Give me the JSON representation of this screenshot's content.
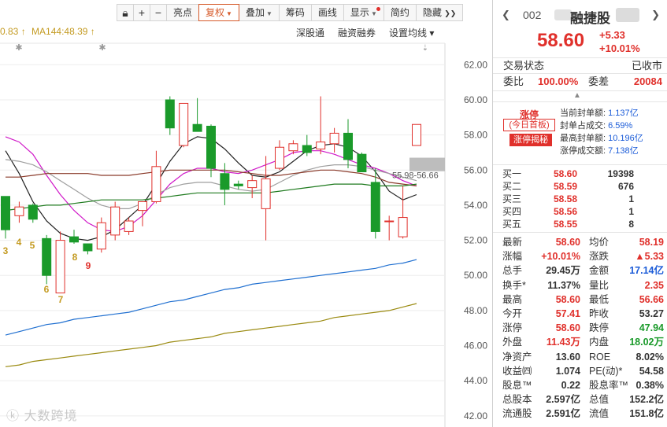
{
  "toolbar": {
    "lock_icon": "lock-icon",
    "zoom_in": "+",
    "zoom_out": "−",
    "highlights": "亮点",
    "adjust": "复权",
    "overlay": "叠加",
    "chips": "筹码",
    "draw": "画线",
    "display": "显示",
    "simple": "简约",
    "hide": "隐藏",
    "more": "❯❯"
  },
  "ma_legend": {
    "left_value": "0.83 ↑",
    "ma144": "MA144:48.39 ↑"
  },
  "chart_links": [
    "深股通",
    "融资融券",
    "设置均线 ▾"
  ],
  "chart_data": {
    "type": "candlestick",
    "y_ticks": [
      "62.00",
      "60.00",
      "58.00",
      "56.00",
      "54.00",
      "52.00",
      "50.00",
      "48.00",
      "46.00",
      "44.00",
      "42.00"
    ],
    "ylim": [
      41.5,
      63
    ],
    "price_range_label": "55.98-56.66",
    "day_labels": [
      {
        "text": "3",
        "color": "#c49b22"
      },
      {
        "text": "4",
        "color": "#c49b22"
      },
      {
        "text": "5",
        "color": "#c49b22"
      },
      {
        "text": "6",
        "color": "#c49b22"
      },
      {
        "text": "7",
        "color": "#c49b22"
      },
      {
        "text": "8",
        "color": "#c49b22"
      },
      {
        "text": "9",
        "color": "#e0302b"
      }
    ],
    "candles": [
      {
        "o": 54.5,
        "h": 54.5,
        "l": 52.1,
        "c": 52.6
      },
      {
        "o": 53.4,
        "h": 54.2,
        "l": 53.0,
        "c": 53.9
      },
      {
        "o": 54.0,
        "h": 54.1,
        "l": 53.0,
        "c": 53.2
      },
      {
        "o": 52.1,
        "h": 52.3,
        "l": 49.5,
        "c": 50.0
      },
      {
        "o": 49.0,
        "h": 52.5,
        "l": 49.0,
        "c": 52.0
      },
      {
        "o": 52.2,
        "h": 52.6,
        "l": 51.8,
        "c": 51.9
      },
      {
        "o": 51.8,
        "h": 51.8,
        "l": 51.2,
        "c": 51.4
      },
      {
        "o": 51.5,
        "h": 53.3,
        "l": 51.3,
        "c": 53.0
      },
      {
        "o": 52.3,
        "h": 54.2,
        "l": 52.0,
        "c": 53.9
      },
      {
        "o": 52.5,
        "h": 53.3,
        "l": 52.3,
        "c": 53.1
      },
      {
        "o": 53.7,
        "h": 54.2,
        "l": 52.8,
        "c": 54.2
      },
      {
        "o": 54.2,
        "h": 57.1,
        "l": 54.1,
        "c": 56.2
      },
      {
        "o": 60.0,
        "h": 60.2,
        "l": 58.0,
        "c": 58.4
      },
      {
        "o": 57.4,
        "h": 59.8,
        "l": 57.3,
        "c": 59.8
      },
      {
        "o": 58.6,
        "h": 60.1,
        "l": 58.2,
        "c": 58.2
      },
      {
        "o": 58.5,
        "h": 58.6,
        "l": 55.6,
        "c": 56.1
      },
      {
        "o": 55.8,
        "h": 56.4,
        "l": 54.0,
        "c": 54.9
      },
      {
        "o": 55.2,
        "h": 55.4,
        "l": 54.9,
        "c": 55.1
      },
      {
        "o": 55.0,
        "h": 55.7,
        "l": 54.4,
        "c": 55.4
      },
      {
        "o": 53.8,
        "h": 56.8,
        "l": 52.0,
        "c": 55.5
      },
      {
        "o": 56.1,
        "h": 57.7,
        "l": 56.0,
        "c": 57.3
      },
      {
        "o": 57.1,
        "h": 57.7,
        "l": 56.9,
        "c": 57.5
      },
      {
        "o": 57.4,
        "h": 58.0,
        "l": 56.8,
        "c": 57.0
      },
      {
        "o": 57.2,
        "h": 60.2,
        "l": 56.9,
        "c": 57.6
      },
      {
        "o": 57.5,
        "h": 58.4,
        "l": 57.0,
        "c": 58.1
      },
      {
        "o": 58.1,
        "h": 58.9,
        "l": 56.1,
        "c": 56.6
      },
      {
        "o": 56.9,
        "h": 57.0,
        "l": 55.9,
        "c": 55.9
      },
      {
        "o": 55.3,
        "h": 56.1,
        "l": 52.1,
        "c": 52.5
      },
      {
        "o": 53.1,
        "h": 53.4,
        "l": 52.0,
        "c": 53.1
      },
      {
        "o": 52.2,
        "h": 55.1,
        "l": 52.1,
        "c": 53.3
      },
      {
        "o": 57.4,
        "h": 58.6,
        "l": 57.4,
        "c": 58.6
      }
    ],
    "series": [
      {
        "color": "#222222",
        "values": [
          57.1,
          55.8,
          54.2,
          53.1,
          52.4,
          52.1,
          52.0,
          52.2,
          52.6,
          53.3,
          54.0,
          55.2,
          56.5,
          57.5,
          57.9,
          57.8,
          57.2,
          56.4,
          55.7,
          55.6,
          55.9,
          56.5,
          57.1,
          57.4,
          57.5,
          57.3,
          56.8,
          55.9,
          54.8,
          54.3,
          54.6
        ]
      },
      {
        "color": "#d018c8",
        "values": [
          57.9,
          57.6,
          56.9,
          55.7,
          54.6,
          53.7,
          53.0,
          52.6,
          52.5,
          52.8,
          53.4,
          54.3,
          55.2,
          55.8,
          56.1,
          56.1,
          55.9,
          55.8,
          56.0,
          56.3,
          56.6,
          57.0,
          57.1,
          57.1,
          56.9,
          56.6,
          56.3,
          56.1,
          55.8,
          55.4,
          55.1
        ]
      },
      {
        "color": "#9e9e9e",
        "values": [
          56.6,
          56.5,
          56.3,
          55.9,
          55.4,
          54.9,
          54.4,
          54.0,
          53.8,
          53.8,
          54.1,
          54.6,
          55.0,
          55.2,
          55.3,
          55.3,
          55.1,
          54.9,
          54.8,
          54.9,
          55.3,
          55.7,
          56.0,
          56.2,
          56.3,
          56.3,
          56.2,
          56.0,
          55.8,
          55.6,
          55.4
        ]
      },
      {
        "color": "#8a3a2a",
        "values": [
          55.6,
          55.6,
          55.7,
          55.8,
          55.8,
          55.8,
          55.8,
          55.7,
          55.7,
          55.7,
          55.8,
          55.9,
          56.0,
          56.0,
          56.0,
          56.0,
          56.0,
          55.9,
          55.8,
          55.7,
          55.7,
          55.8,
          55.9,
          56.0,
          56.0,
          55.9,
          55.8,
          55.6,
          55.3,
          55.2,
          55.1
        ]
      },
      {
        "color": "#1e7a1e",
        "values": [
          53.7,
          53.8,
          53.9,
          54.0,
          54.0,
          54.1,
          54.2,
          54.3,
          54.3,
          54.3,
          54.3,
          54.4,
          54.5,
          54.6,
          54.7,
          54.7,
          54.7,
          54.7,
          54.7,
          54.7,
          54.8,
          54.9,
          55.0,
          55.1,
          55.2,
          55.2,
          55.2,
          55.1,
          55.1,
          55.1,
          55.2
        ]
      },
      {
        "color": "#1f6fd0",
        "values": [
          46.6,
          46.8,
          47.0,
          47.2,
          47.3,
          47.5,
          47.6,
          47.7,
          47.8,
          47.9,
          48.1,
          48.3,
          48.5,
          48.6,
          48.8,
          49.0,
          49.2,
          49.3,
          49.5,
          49.6,
          49.7,
          49.8,
          49.9,
          50.0,
          50.1,
          50.2,
          50.3,
          50.4,
          50.6,
          50.7,
          50.9
        ]
      },
      {
        "color": "#9a8a10",
        "values": [
          44.8,
          44.9,
          45.1,
          45.2,
          45.3,
          45.4,
          45.5,
          45.6,
          45.7,
          45.8,
          45.9,
          46.0,
          46.2,
          46.3,
          46.4,
          46.5,
          46.7,
          46.8,
          46.9,
          47.0,
          47.1,
          47.2,
          47.3,
          47.4,
          47.6,
          47.7,
          47.8,
          47.9,
          48.0,
          48.2,
          48.4
        ]
      }
    ]
  },
  "watermark": "大数跨境",
  "stock": {
    "code": "002",
    "name": "融捷股",
    "price": "58.60",
    "change": "+5.33",
    "change_pct": "+10.01%"
  },
  "status": {
    "label": "交易状态",
    "value": "已收市",
    "weibi_label": "委比",
    "weibi_value": "100.00%",
    "weicha_label": "委差",
    "weicha_value": "20084"
  },
  "limit_up": {
    "title": "涨停",
    "first_board": "(今日首板)",
    "secret": "涨停揭秘",
    "lines": [
      {
        "label": "当前封单额:",
        "value": "1.137亿"
      },
      {
        "label": "封单占成交:",
        "value": "6.59%"
      },
      {
        "label": "最高封单额:",
        "value": "10.196亿"
      },
      {
        "label": "涨停成交额:",
        "value": "7.138亿"
      }
    ]
  },
  "order_book": [
    {
      "label": "买一",
      "price": "58.60",
      "vol": "19398"
    },
    {
      "label": "买二",
      "price": "58.59",
      "vol": "676"
    },
    {
      "label": "买三",
      "price": "58.58",
      "vol": "1"
    },
    {
      "label": "买四",
      "price": "58.56",
      "vol": "1"
    },
    {
      "label": "买五",
      "price": "58.55",
      "vol": "8"
    }
  ],
  "stats": [
    {
      "l1": "最新",
      "v1": "58.60",
      "c1": "red",
      "l2": "均价",
      "v2": "58.19",
      "c2": "red"
    },
    {
      "l1": "涨幅",
      "v1": "+10.01%",
      "c1": "red",
      "l2": "涨跌",
      "v2": "▲5.33",
      "c2": "red"
    },
    {
      "l1": "总手",
      "v1": "29.45万",
      "c1": "dark",
      "l2": "金额",
      "v2": "17.14亿",
      "c2": "blue"
    },
    {
      "l1": "换手*",
      "v1": "11.37%",
      "c1": "dark",
      "l2": "量比",
      "v2": "2.35",
      "c2": "red"
    },
    {
      "l1": "最高",
      "v1": "58.60",
      "c1": "red",
      "l2": "最低",
      "v2": "56.66",
      "c2": "red"
    },
    {
      "l1": "今开",
      "v1": "57.41",
      "c1": "red",
      "l2": "昨收",
      "v2": "53.27",
      "c2": "dark"
    },
    {
      "l1": "涨停",
      "v1": "58.60",
      "c1": "red",
      "l2": "跌停",
      "v2": "47.94",
      "c2": "green"
    },
    {
      "l1": "外盘",
      "v1": "11.43万",
      "c1": "red",
      "l2": "内盘",
      "v2": "18.02万",
      "c2": "green"
    },
    {
      "l1": "净资产",
      "v1": "13.60",
      "c1": "dark",
      "l2": "ROE",
      "v2": "8.02%",
      "c2": "dark"
    },
    {
      "l1": "收益㈣",
      "v1": "1.074",
      "c1": "dark",
      "l2": "PE(动)*",
      "v2": "54.58",
      "c2": "dark"
    },
    {
      "l1": "股息™",
      "v1": "0.22",
      "c1": "dark",
      "l2": "股息率™",
      "v2": "0.38%",
      "c2": "dark"
    },
    {
      "l1": "总股本",
      "v1": "2.597亿",
      "c1": "dark",
      "l2": "总值",
      "v2": "152.2亿",
      "c2": "dark"
    },
    {
      "l1": "流通股",
      "v1": "2.591亿",
      "c1": "dark",
      "l2": "流值",
      "v2": "151.8亿",
      "c2": "dark"
    }
  ]
}
